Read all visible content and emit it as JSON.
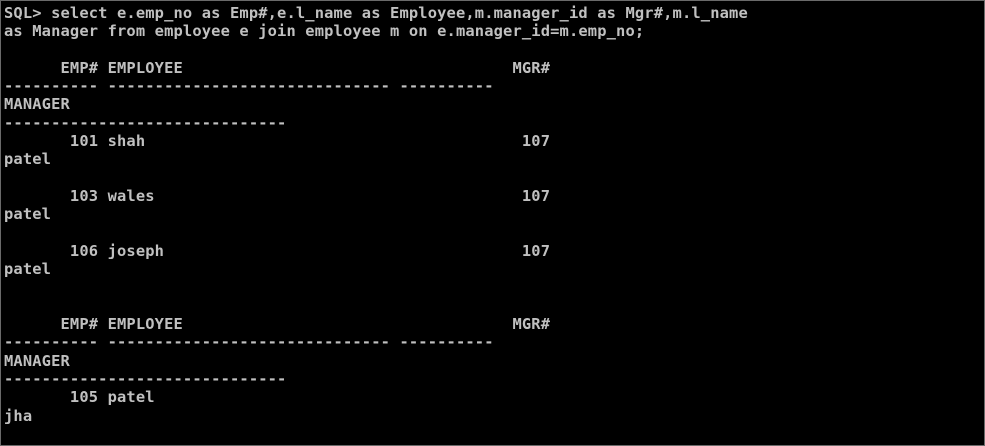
{
  "console": {
    "colors": {
      "background": "#000000",
      "text": "#c0c0c0"
    },
    "lines": [
      "SQL> select e.emp_no as Emp#,e.l_name as Employee,m.manager_id as Mgr#,m.l_name",
      "as Manager from employee e join employee m on e.manager_id=m.emp_no;",
      "",
      "      EMP# EMPLOYEE                                   MGR#",
      "---------- ------------------------------ ----------",
      "MANAGER",
      "------------------------------",
      "       101 shah                                        107",
      "patel",
      "",
      "       103 wales                                       107",
      "patel",
      "",
      "       106 joseph                                      107",
      "patel",
      "",
      "",
      "      EMP# EMPLOYEE                                   MGR#",
      "---------- ------------------------------ ----------",
      "MANAGER",
      "------------------------------",
      "       105 patel",
      "jha"
    ]
  }
}
